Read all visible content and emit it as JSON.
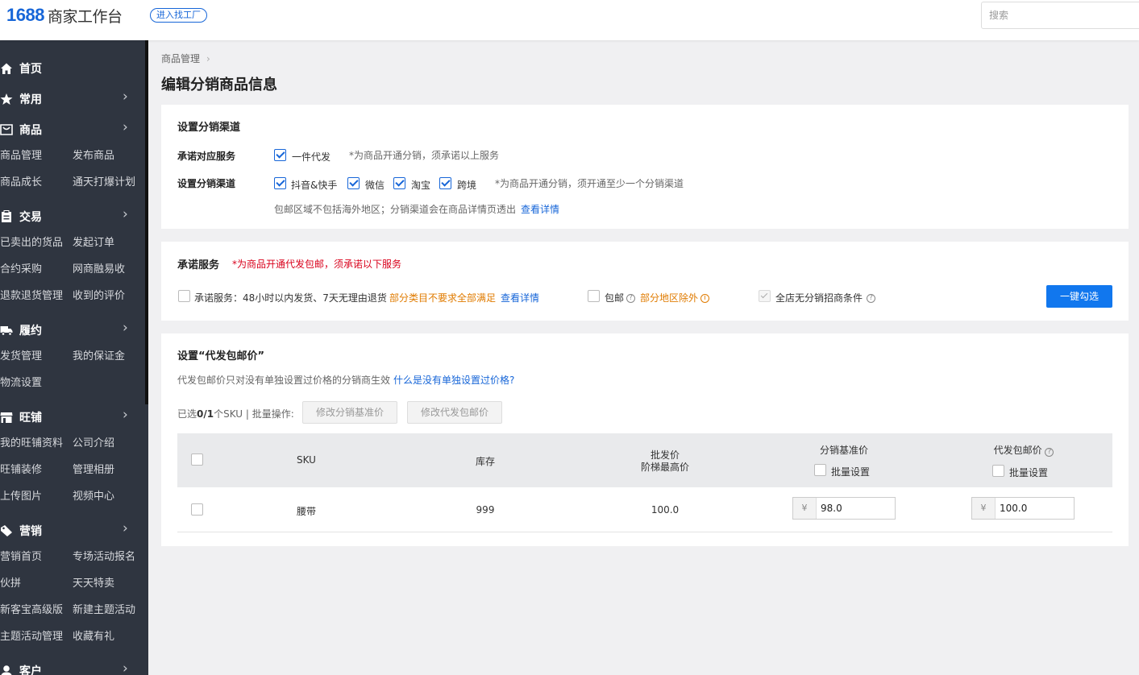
{
  "header": {
    "logo_num": "1688",
    "logo_text": "商家工作台",
    "factory_btn": "进入找工厂",
    "search_placeholder": "搜索"
  },
  "sidebar": {
    "sections": [
      {
        "label": "首页",
        "icon": "home-icon"
      },
      {
        "label": "常用",
        "icon": "star-icon"
      },
      {
        "label": "商品",
        "icon": "bag-icon",
        "items": [
          "商品管理",
          "发布商品",
          "商品成长",
          "通天打爆计划"
        ]
      },
      {
        "label": "交易",
        "icon": "clipboard-icon",
        "items": [
          "已卖出的货品",
          "发起订单",
          "合约采购",
          "网商融易收",
          "退款退货管理",
          "收到的评价"
        ]
      },
      {
        "label": "履约",
        "icon": "truck-icon",
        "items": [
          "发货管理",
          "我的保证金",
          "物流设置"
        ]
      },
      {
        "label": "旺铺",
        "icon": "shop-icon",
        "items": [
          "我的旺铺资料",
          "公司介绍",
          "旺铺装修",
          "管理相册",
          "上传图片",
          "视频中心"
        ]
      },
      {
        "label": "营销",
        "icon": "tag-icon",
        "items": [
          "营销首页",
          "专场活动报名",
          "伙拼",
          "天天特卖",
          "新客宝高级版",
          "新建主题活动",
          "主题活动管理",
          "收藏有礼"
        ]
      },
      {
        "label": "客户",
        "icon": "user-icon"
      }
    ]
  },
  "breadcrumb": {
    "item": "商品管理",
    "sep": "›"
  },
  "page_title": "编辑分销商品信息",
  "channel_card": {
    "title": "设置分销渠道",
    "service_label": "承诺对应服务",
    "service_option": "一件代发",
    "service_note": "*为商品开通分销，须承诺以上服务",
    "channel_label": "设置分销渠道",
    "channels": [
      "抖音&快手",
      "微信",
      "淘宝",
      "跨境"
    ],
    "channel_note": "*为商品开通分销，须开通至少一个分销渠道",
    "region_note": "包邮区域不包括海外地区；分销渠道会在商品详情页透出",
    "region_link": "查看详情"
  },
  "promise_card": {
    "title": "承诺服务",
    "title_note": "*为商品开通代发包邮，须承诺以下服务",
    "service_text": "承诺服务：48小时以内发货、7天无理由退货",
    "service_warn": "部分类目不要求全部满足",
    "service_link": "查看详情",
    "free_ship": "包邮",
    "free_ship_warn": "部分地区除外",
    "no_condition": "全店无分销招商条件",
    "one_click": "一键勾选"
  },
  "price_card": {
    "title": "设置“代发包邮价”",
    "desc": "代发包邮价只对没有单独设置过价格的分销商生效",
    "desc_link": "什么是没有单独设置过价格?",
    "selected_prefix": "已选",
    "selected_count": "0/1",
    "selected_suffix": "个SKU | 批量操作:",
    "btn_base": "修改分销基准价",
    "btn_ship": "修改代发包邮价",
    "columns": {
      "sku": "SKU",
      "stock": "库存",
      "wholesale_line1": "批发价",
      "wholesale_line2": "阶梯最高价",
      "base": "分销基准价",
      "ship": "代发包邮价",
      "batch": "批量设置"
    },
    "rows": [
      {
        "sku": "腰带",
        "stock": "999",
        "wholesale": "100.0",
        "currency": "¥",
        "base": "98.0",
        "ship": "100.0"
      }
    ]
  }
}
